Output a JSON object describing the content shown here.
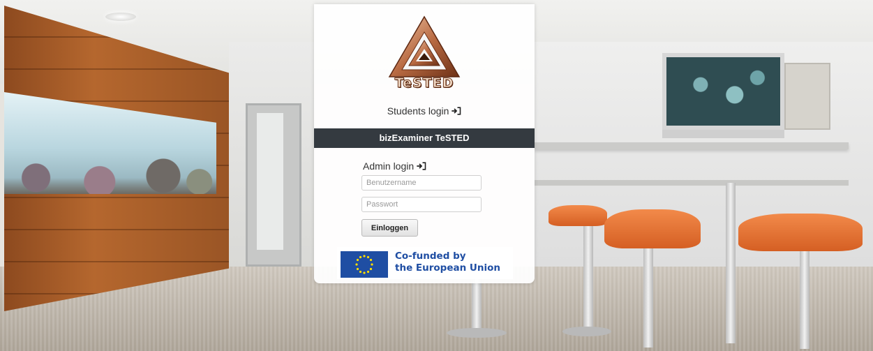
{
  "branding": {
    "logo_text": "TeSTED",
    "logo_colors": {
      "bronze_light": "#e9b594",
      "bronze_dark": "#7a3a1c"
    }
  },
  "students_login": {
    "label": "Students login",
    "icon": "login-icon"
  },
  "header_band": {
    "title": "bizExaminer TeSTED",
    "color": "#343a40"
  },
  "admin_login": {
    "label": "Admin login",
    "icon": "login-icon",
    "username": {
      "placeholder": "Benutzername",
      "value": ""
    },
    "password": {
      "placeholder": "Passwort",
      "value": ""
    },
    "submit_label": "Einloggen"
  },
  "eu_badge": {
    "line1": "Co-funded by",
    "line2": "the European Union",
    "flag_color": "#1f4ea3",
    "star_color": "#ffdd00"
  }
}
